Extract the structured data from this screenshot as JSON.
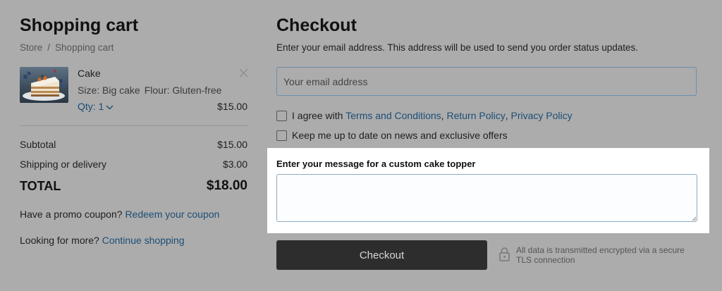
{
  "cart": {
    "title": "Shopping cart",
    "breadcrumb": {
      "store": "Store",
      "separator": "/",
      "current": "Shopping cart"
    },
    "item": {
      "name": "Cake",
      "size": "Size: Big cake",
      "flour": "Flour: Gluten-free",
      "qty": "Qty: 1",
      "price": "$15.00",
      "thumbnail_icon": "cake-slice-image",
      "remove_icon": "close-icon"
    },
    "summary": {
      "subtotal_label": "Subtotal",
      "subtotal_value": "$15.00",
      "shipping_label": "Shipping or delivery",
      "shipping_value": "$3.00",
      "total_label": "TOTAL",
      "total_value": "$18.00"
    },
    "promo": {
      "text": "Have a promo coupon?",
      "link": "Redeem your coupon"
    },
    "more": {
      "text": "Looking for more?",
      "link": "Continue shopping"
    }
  },
  "checkout": {
    "title": "Checkout",
    "email_description": "Enter your email address. This address will be used to send you order status updates.",
    "email_placeholder": "Your email address",
    "agree": {
      "prefix": "I agree with",
      "terms": "Terms and Conditions",
      "comma1": ",",
      "returns": "Return Policy",
      "comma2": ",",
      "privacy": "Privacy Policy",
      "checked": false
    },
    "newsletter": {
      "label": "Keep me up to date on news and exclusive offers",
      "checked": false
    },
    "message_label": "Enter your message for a custom cake topper",
    "button_label": "Checkout",
    "secure_note": "All data is transmitted encrypted via a secure TLS connection",
    "lock_icon": "lock-icon"
  },
  "colors": {
    "background": "#acacac",
    "link": "#1b4e76",
    "button": "#2d2d2d",
    "highlight": "#ffffff"
  }
}
